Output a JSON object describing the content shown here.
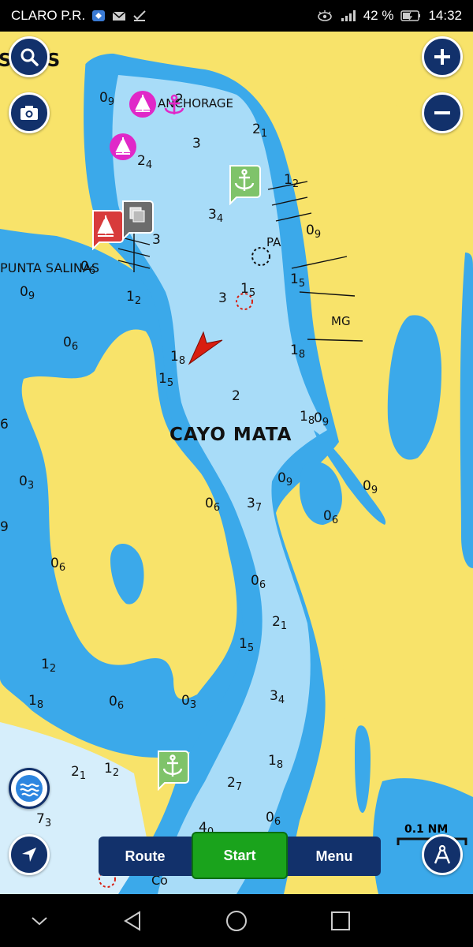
{
  "status_bar": {
    "carrier": "CLARO P.R.",
    "battery": "42 %",
    "time": "14:32"
  },
  "map": {
    "place_names": {
      "top_left_fragment": "S NAS",
      "anchorage": "ANCHORAGE",
      "punta_salinas": "PUNTA SALINAS",
      "cayo_mata": "CAYO MATA",
      "pa": "PA",
      "mg": "MG",
      "co": "Co"
    },
    "soundings": [
      {
        "main": "0",
        "sub": "9"
      },
      {
        "main": "2",
        "sub": ""
      },
      {
        "main": "2",
        "sub": "1"
      },
      {
        "main": "3",
        "sub": ""
      },
      {
        "main": "2",
        "sub": "4"
      },
      {
        "main": "1",
        "sub": "2"
      },
      {
        "main": "3",
        "sub": "4"
      },
      {
        "main": "0",
        "sub": "9"
      },
      {
        "main": "3",
        "sub": ""
      },
      {
        "main": "0",
        "sub": "6"
      },
      {
        "main": "0",
        "sub": "9"
      },
      {
        "main": "1",
        "sub": "2"
      },
      {
        "main": "3",
        "sub": ""
      },
      {
        "main": "1",
        "sub": "5"
      },
      {
        "main": "1",
        "sub": "5"
      },
      {
        "main": "0",
        "sub": "6"
      },
      {
        "main": "1",
        "sub": "8"
      },
      {
        "main": "1",
        "sub": "8"
      },
      {
        "main": "1",
        "sub": "5"
      },
      {
        "main": "2",
        "sub": ""
      },
      {
        "main": "1",
        "sub": "8"
      },
      {
        "main": "0",
        "sub": "9"
      },
      {
        "main": "0",
        "sub": "3"
      },
      {
        "main": "0",
        "sub": "9"
      },
      {
        "main": "0",
        "sub": "9"
      },
      {
        "main": "0",
        "sub": "6"
      },
      {
        "main": "3",
        "sub": "7"
      },
      {
        "main": "0",
        "sub": "6"
      },
      {
        "main": "0",
        "sub": "6"
      },
      {
        "main": "0",
        "sub": "6"
      },
      {
        "main": "2",
        "sub": "1"
      },
      {
        "main": "1",
        "sub": "5"
      },
      {
        "main": "1",
        "sub": "2"
      },
      {
        "main": "1",
        "sub": "8"
      },
      {
        "main": "0",
        "sub": "6"
      },
      {
        "main": "0",
        "sub": "3"
      },
      {
        "main": "3",
        "sub": "4"
      },
      {
        "main": "2",
        "sub": "1"
      },
      {
        "main": "1",
        "sub": "2"
      },
      {
        "main": "1",
        "sub": "8"
      },
      {
        "main": "2",
        "sub": "7"
      },
      {
        "main": "7",
        "sub": "3"
      },
      {
        "main": "4",
        "sub": "0"
      },
      {
        "main": "0",
        "sub": "6"
      },
      {
        "main": "9",
        "sub": ""
      },
      {
        "main": "6",
        "sub": ""
      }
    ],
    "scale_label": "0.1 NM",
    "colors": {
      "land": "#f8e36a",
      "shallow_water": "#3ba9ea",
      "deep_water": "#a8dcf8",
      "very_deep_water": "#d6eefb",
      "brand": "#12316b",
      "start_green": "#1aa31c",
      "vessel_red": "#d81e10",
      "anchorage_magenta": "#e028c8"
    }
  },
  "controls": {
    "search_icon": "search-icon",
    "camera_icon": "camera-icon",
    "zoom_in_icon": "plus-icon",
    "zoom_out_icon": "minus-icon",
    "layers_icon": "layers-icon",
    "locate_icon": "navigation-arrow-icon",
    "compass_icon": "compass-icon"
  },
  "bottom_tabs": {
    "route": "Route",
    "start": "Start",
    "menu": "Menu"
  }
}
